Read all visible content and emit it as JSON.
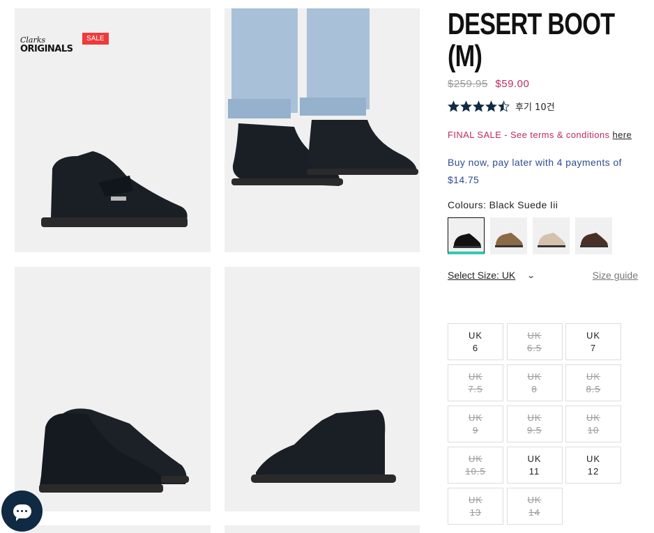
{
  "gallery": {
    "brand_script": "Clarks",
    "brand_word": "ORIGINALS",
    "badge": "SALE"
  },
  "product": {
    "title_line1": "DESERT BOOT",
    "title_line2": "(M)",
    "old_price": "$259.95",
    "new_price": "$59.00",
    "rating": 4.5,
    "reviews": "후기 10건",
    "final_sale_text": "FINAL SALE - See terms & conditions",
    "final_sale_link": "here",
    "bnpl_text": "Buy now, pay later with 4 payments of $14.75",
    "colours_label": "Colours: Black Suede Iii",
    "swatch_colors": [
      "#111111",
      "#8a6a47",
      "#d5c2ae",
      "#4a3024"
    ],
    "size_select_label": "Select Size: UK",
    "size_guide": "Size guide"
  },
  "sizes": [
    {
      "label": "UK",
      "value": "6",
      "available": true
    },
    {
      "label": "UK",
      "value": "6.5",
      "available": false
    },
    {
      "label": "UK",
      "value": "7",
      "available": true
    },
    {
      "label": "UK",
      "value": "7.5",
      "available": false
    },
    {
      "label": "UK",
      "value": "8",
      "available": false
    },
    {
      "label": "UK",
      "value": "8.5",
      "available": false
    },
    {
      "label": "UK",
      "value": "9",
      "available": false
    },
    {
      "label": "UK",
      "value": "9.5",
      "available": false
    },
    {
      "label": "UK",
      "value": "10",
      "available": false
    },
    {
      "label": "UK",
      "value": "10.5",
      "available": false
    },
    {
      "label": "UK",
      "value": "11",
      "available": true
    },
    {
      "label": "UK",
      "value": "12",
      "available": true
    },
    {
      "label": "UK",
      "value": "13",
      "available": false
    },
    {
      "label": "UK",
      "value": "14",
      "available": false
    }
  ],
  "icons": {
    "chat": "chat-icon",
    "chevron": "chevron-down-icon",
    "star": "star-icon"
  }
}
